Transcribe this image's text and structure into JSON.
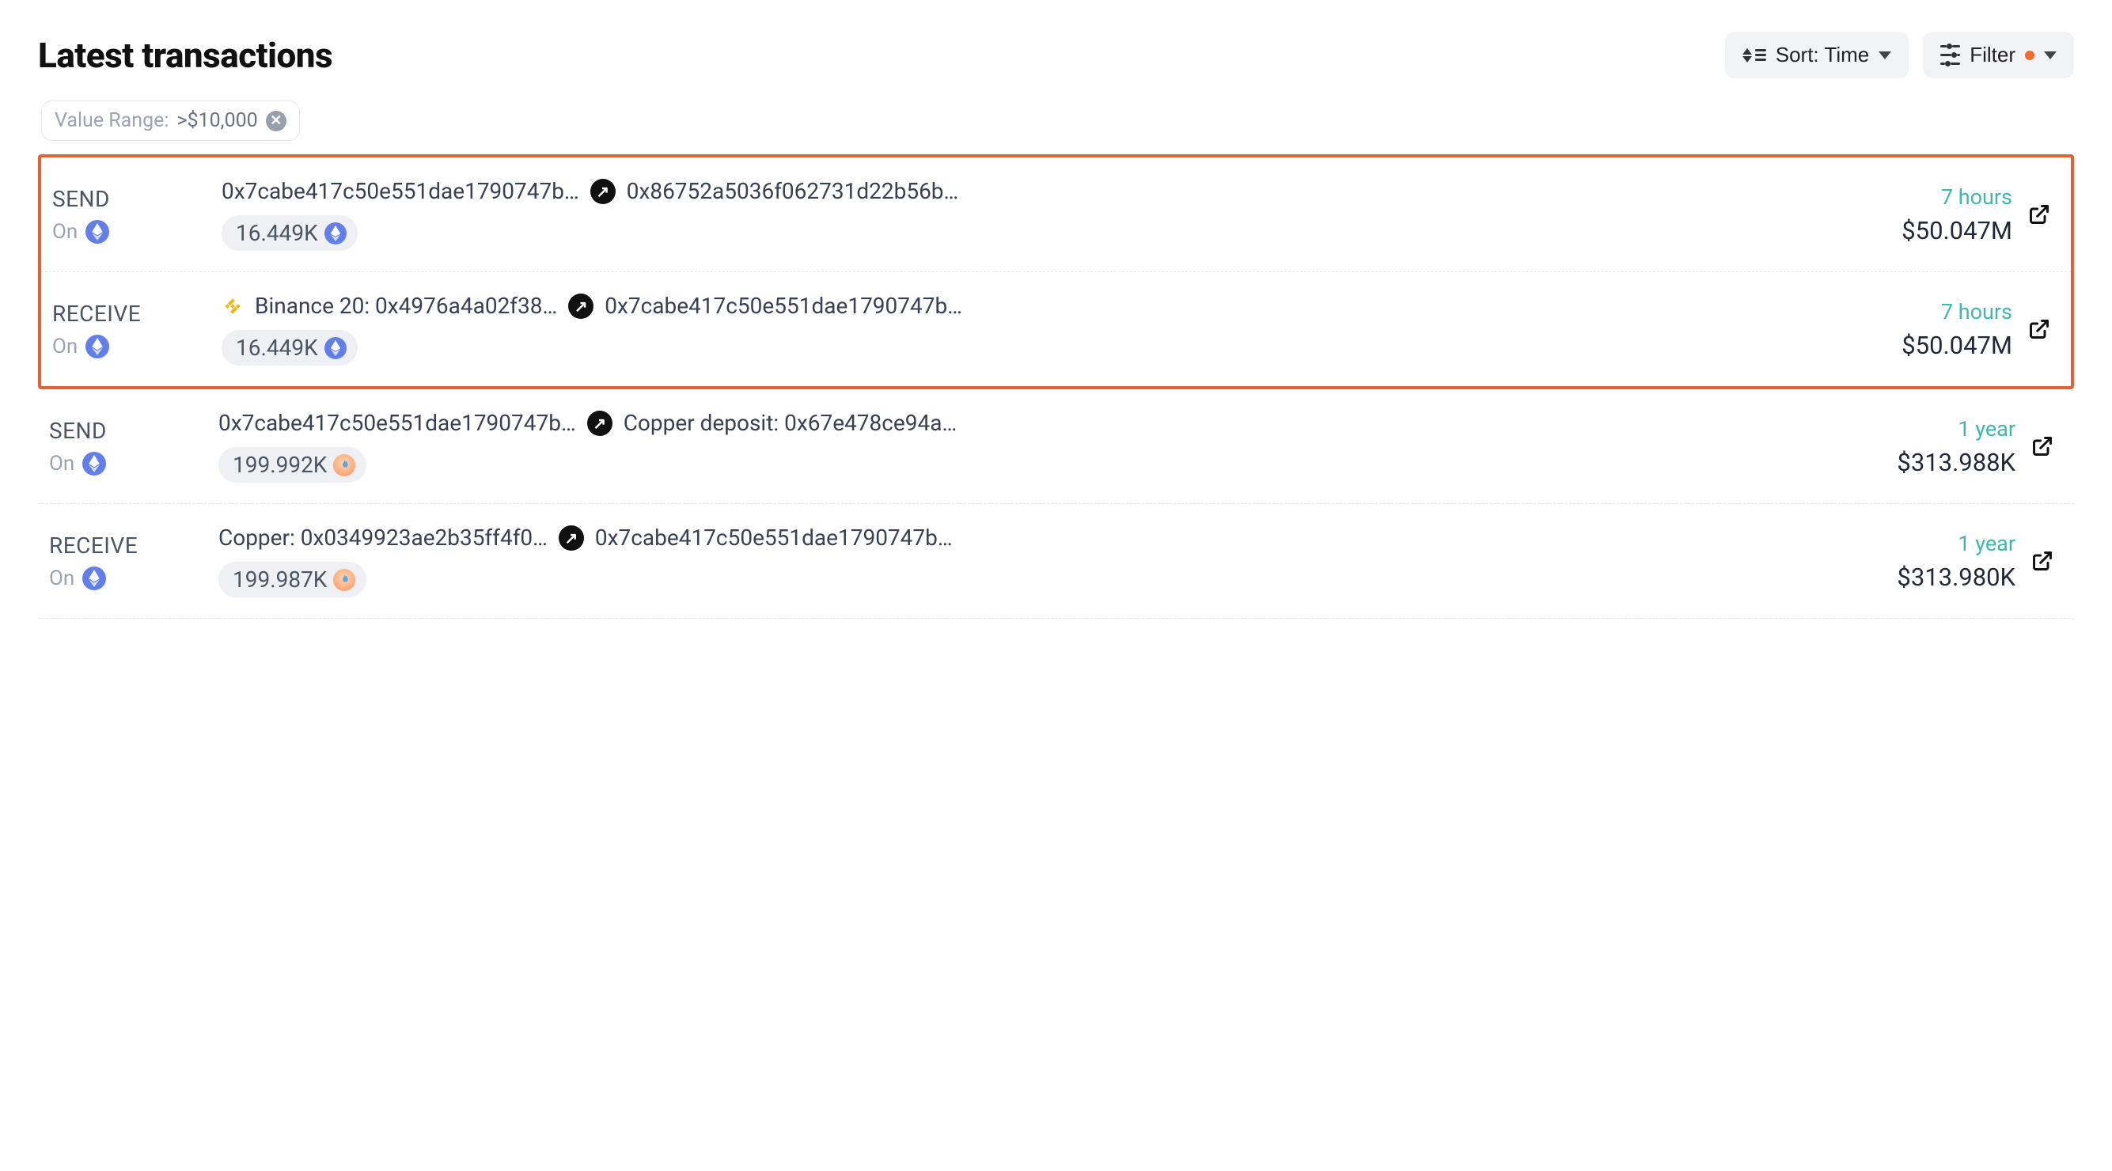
{
  "header": {
    "title": "Latest transactions",
    "sort_label": "Sort: Time",
    "filter_label": "Filter"
  },
  "filter_chip": {
    "prefix": "Value Range:",
    "value": ">$10,000"
  },
  "labels": {
    "on": "On"
  },
  "transactions": [
    {
      "type": "SEND",
      "chain": "eth",
      "from_icon": null,
      "from": "0x7cabe417c50e551dae1790747b…",
      "to": "0x86752a5036f062731d22b56b…",
      "amount": "16.449K",
      "amount_coin": "eth",
      "time": "7 hours",
      "usd": "$50.047M",
      "highlight": true
    },
    {
      "type": "RECEIVE",
      "chain": "eth",
      "from_icon": "bnb",
      "from": "Binance 20: 0x4976a4a02f38…",
      "to": "0x7cabe417c50e551dae1790747b…",
      "amount": "16.449K",
      "amount_coin": "eth",
      "time": "7 hours",
      "usd": "$50.047M",
      "highlight": true
    },
    {
      "type": "SEND",
      "chain": "eth",
      "from_icon": null,
      "from": "0x7cabe417c50e551dae1790747b…",
      "to": "Copper deposit: 0x67e478ce94a…",
      "amount": "199.992K",
      "amount_coin": "flame",
      "time": "1 year",
      "usd": "$313.988K",
      "highlight": false
    },
    {
      "type": "RECEIVE",
      "chain": "eth",
      "from_icon": null,
      "from": "Copper: 0x0349923ae2b35ff4f0…",
      "to": "0x7cabe417c50e551dae1790747b…",
      "amount": "199.987K",
      "amount_coin": "flame",
      "time": "1 year",
      "usd": "$313.980K",
      "highlight": false
    }
  ]
}
